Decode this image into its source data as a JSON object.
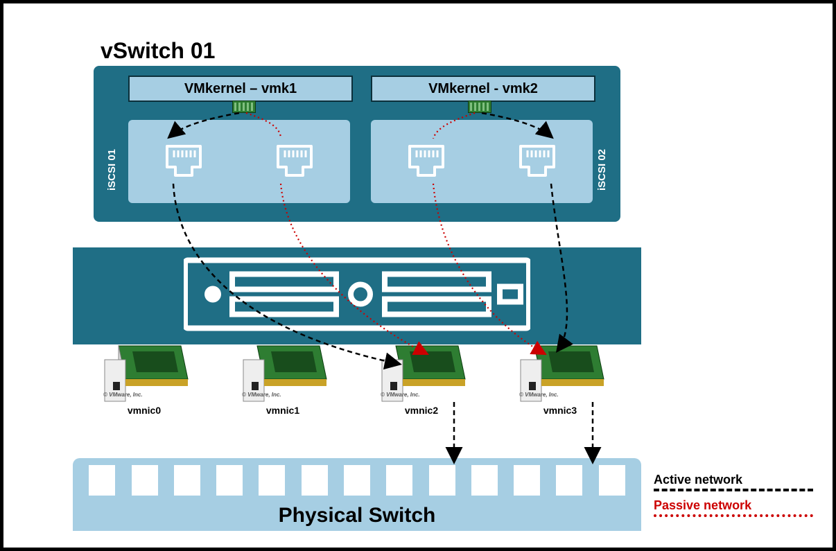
{
  "title": "vSwitch 01",
  "vswitch": {
    "vmk_left": "VMkernel – vmk1",
    "vmk_right": "VMkernel - vmk2",
    "iscsi_left": "iSCSI 01",
    "iscsi_right": "iSCSI 02"
  },
  "nics": {
    "n0": "vmnic0",
    "n1": "vmnic1",
    "n2": "vmnic2",
    "n3": "vmnic3",
    "credit": "© VMware, Inc."
  },
  "physical_switch": "Physical Switch",
  "legend": {
    "active": "Active  network",
    "passive": "Passive  network"
  },
  "connections": {
    "active": [
      {
        "from": "vmk1",
        "to_portgroup": "iSCSI 01 left port",
        "to_nic": "vmnic2"
      },
      {
        "from": "vmk2",
        "to_portgroup": "iSCSI 02 right port",
        "to_nic": "vmnic3"
      },
      {
        "from": "vmnic2",
        "to": "physical switch port"
      },
      {
        "from": "vmnic3",
        "to": "physical switch port"
      }
    ],
    "passive": [
      {
        "from": "vmk1",
        "to_portgroup": "iSCSI 01 right port",
        "to_nic": "vmnic2"
      },
      {
        "from": "vmk2",
        "to_portgroup": "iSCSI 02 left port",
        "to_nic": "vmnic3"
      }
    ]
  }
}
